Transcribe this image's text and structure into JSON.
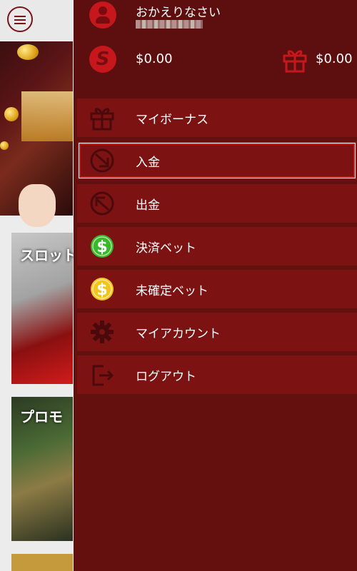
{
  "drawer": {
    "welcome": "おかえりなさい",
    "balance_cash": "$0.00",
    "balance_bonus": "$0.00",
    "menu": [
      {
        "label": "マイボーナス",
        "icon": "gift-icon"
      },
      {
        "label": "入金",
        "icon": "deposit-arrow-icon",
        "selected": true
      },
      {
        "label": "出金",
        "icon": "withdraw-arrow-icon"
      },
      {
        "label": "決済ベット",
        "icon": "dollar-green-icon"
      },
      {
        "label": "未確定ベット",
        "icon": "dollar-yellow-icon"
      },
      {
        "label": "マイアカウント",
        "icon": "gear-icon"
      },
      {
        "label": "ログアウト",
        "icon": "logout-icon"
      }
    ]
  },
  "background": {
    "card1_title": "スロット",
    "card2_title": "プロモ"
  },
  "colors": {
    "drawer_bg": "#64100f",
    "item_bg": "#7d1213",
    "accent_red": "#c5171c",
    "highlight_border": "#d01b1b",
    "green": "#3ab82b",
    "yellow": "#f2c51c"
  }
}
